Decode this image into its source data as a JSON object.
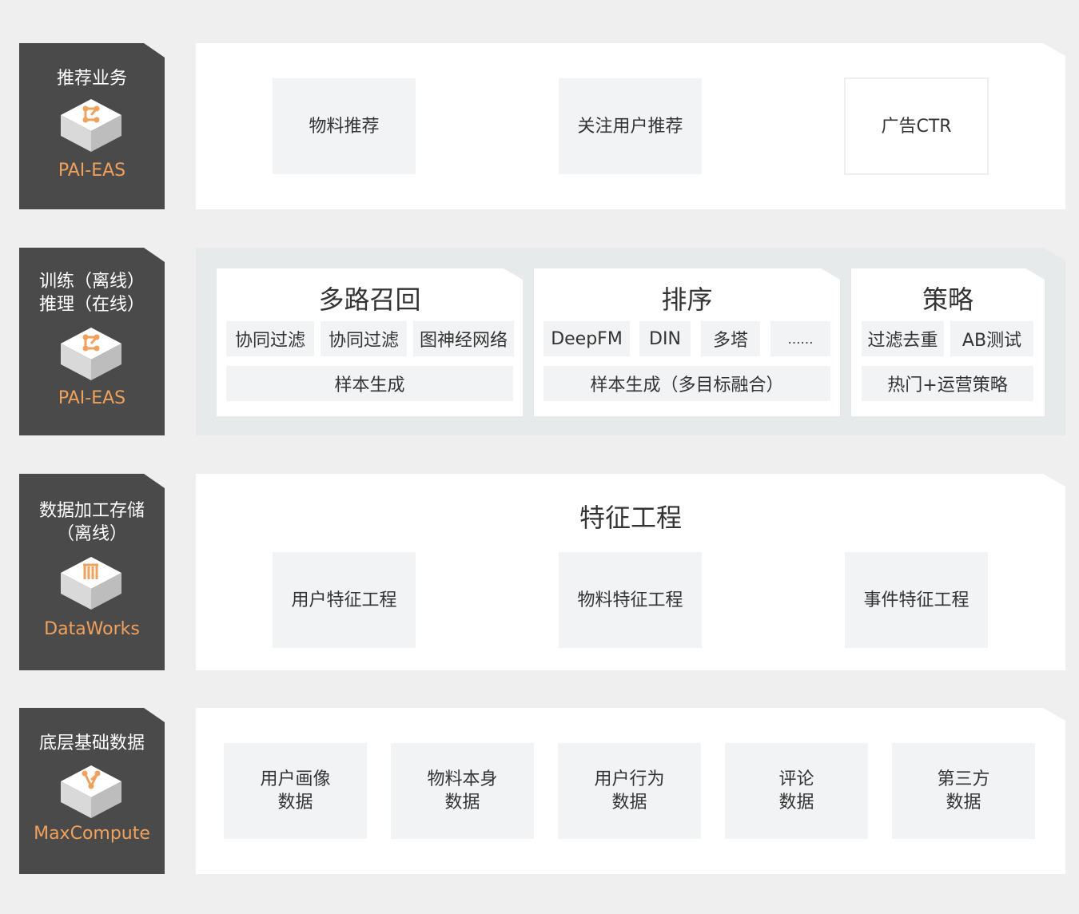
{
  "colors": {
    "sidebar": "#4a4a4a",
    "accent": "#f0a15b",
    "box": "#f1f3f4",
    "bg": "#efefef"
  },
  "layers": [
    {
      "label": "推荐业务",
      "product": "PAI-EAS",
      "icon": "pai-eas-cube-icon"
    },
    {
      "label": "训练（离线）\n推理（在线）",
      "product": "PAI-EAS",
      "icon": "pai-eas-cube-icon"
    },
    {
      "label": "数据加工存储\n（离线）",
      "product": "DataWorks",
      "icon": "dataworks-cube-icon"
    },
    {
      "label": "底层基础数据",
      "product": "MaxCompute",
      "icon": "maxcompute-cube-icon"
    }
  ],
  "business": {
    "items": [
      "物料推荐",
      "关注用户推荐",
      "广告CTR"
    ]
  },
  "training": {
    "recall": {
      "title": "多路召回",
      "chips": [
        "协同过滤",
        "协同过滤",
        "图神经网络"
      ],
      "sample": "样本生成"
    },
    "ranking": {
      "title": "排序",
      "chips": [
        "DeepFM",
        "DIN",
        "多塔",
        "……"
      ],
      "sample": "样本生成（多目标融合）"
    },
    "strategy": {
      "title": "策略",
      "chips": [
        "过滤去重",
        "AB测试"
      ],
      "sample": "热门+运营策略"
    }
  },
  "feature": {
    "title": "特征工程",
    "items": [
      "用户特征工程",
      "物料特征工程",
      "事件特征工程"
    ]
  },
  "base": {
    "items": [
      "用户画像\n数据",
      "物料本身\n数据",
      "用户行为\n数据",
      "评论\n数据",
      "第三方\n数据"
    ]
  }
}
